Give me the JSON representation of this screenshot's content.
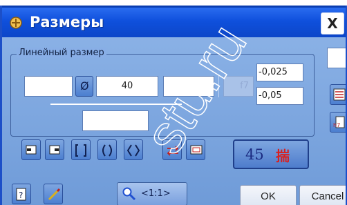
{
  "window": {
    "title": "Размеры",
    "close_label": "X"
  },
  "group": {
    "label": "Линейный размер"
  },
  "fields": {
    "prefix_value": "",
    "diameter_symbol": "Ø",
    "nominal_value": "40",
    "suffix_value": "",
    "fit_value": "f7",
    "upper_tolerance": "-0,025",
    "lower_tolerance": "-0,05",
    "text_below": ""
  },
  "buttons": {
    "angle_value": "45",
    "angle_glyph": "揣",
    "zoom_label": "<1:1>",
    "ok_label": "OK",
    "cancel_label": "Cancel"
  },
  "icons": [
    "text-before-icon",
    "text-after-icon",
    "square-brackets-icon",
    "round-brackets-icon",
    "angle-brackets-icon",
    "swap-arrows-icon",
    "frame-icon",
    "tolerance-table-icon",
    "fit-table-icon",
    "help-icon",
    "pick-icon",
    "zoom-icon"
  ],
  "watermark": {
    "text": "stu.ru"
  },
  "colors": {
    "titlebar": "#0f50dc",
    "dialog": "#7ca4e0",
    "accent_red": "#d82020"
  }
}
